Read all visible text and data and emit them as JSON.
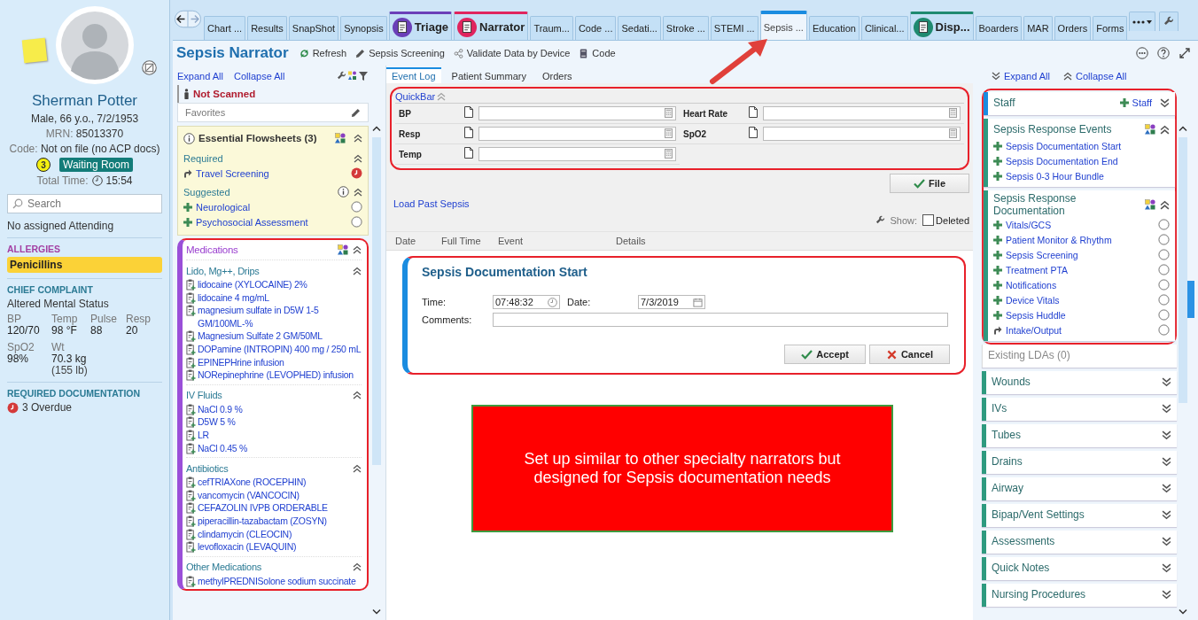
{
  "tabs": [
    {
      "label": "Chart ...",
      "kind": "small",
      "selected": false
    },
    {
      "label": "Results",
      "kind": "small",
      "selected": false
    },
    {
      "label": "SnapShot",
      "kind": "small",
      "selected": false
    },
    {
      "label": "Synopsis",
      "kind": "small",
      "selected": false
    },
    {
      "label": "Triage",
      "kind": "large",
      "selected": false,
      "color": "#6b3fb8"
    },
    {
      "label": "Narrator",
      "kind": "large",
      "selected": false,
      "color": "#e0245e"
    },
    {
      "label": "Traum...",
      "kind": "small",
      "selected": false
    },
    {
      "label": "Code ...",
      "kind": "small",
      "selected": false
    },
    {
      "label": "Sedati...",
      "kind": "small",
      "selected": false
    },
    {
      "label": "Stroke ...",
      "kind": "small",
      "selected": false
    },
    {
      "label": "STEMI ...",
      "kind": "small",
      "selected": false
    },
    {
      "label": "Sepsis ...",
      "kind": "small",
      "selected": true
    },
    {
      "label": "Education",
      "kind": "small",
      "selected": false
    },
    {
      "label": "Clinical...",
      "kind": "small",
      "selected": false
    },
    {
      "label": "Disp...",
      "kind": "large",
      "selected": false,
      "color": "#1f8a70"
    },
    {
      "label": "Boarders",
      "kind": "small",
      "selected": false
    },
    {
      "label": "MAR",
      "kind": "small",
      "selected": false
    },
    {
      "label": "Orders",
      "kind": "small",
      "selected": false
    },
    {
      "label": "Forms",
      "kind": "small",
      "selected": false
    }
  ],
  "patient": {
    "name": "Sherman Potter",
    "demographics": "Male, 66 y.o., 7/2/1953",
    "mrn_label": "MRN:",
    "mrn": "85013370",
    "code_label": "Code:",
    "code": "Not on file (no ACP docs)",
    "acuity": "3",
    "location": "Waiting Room",
    "total_time_label": "Total Time:",
    "total_time": "15:54",
    "search": {
      "placeholder": "Search"
    },
    "attending": "No assigned Attending",
    "allergies_heading": "ALLERGIES",
    "allergies": [
      "Penicillins"
    ],
    "complaint_heading": "CHIEF COMPLAINT",
    "complaint": "Altered Mental Status",
    "vitals": [
      {
        "label": "BP",
        "value": "120/70"
      },
      {
        "label": "Temp",
        "value": "98 °F"
      },
      {
        "label": "Pulse",
        "value": "88"
      },
      {
        "label": "Resp",
        "value": "20"
      },
      {
        "label": "SpO2",
        "value": "98%"
      },
      {
        "label": "Wt",
        "value": "70.3 kg",
        "note": "(155 lb)"
      }
    ],
    "required_heading": "REQUIRED DOCUMENTATION",
    "overdue": "3 Overdue"
  },
  "toolbar": {
    "title": "Sepsis Narrator",
    "actions": [
      {
        "label": "Refresh",
        "kind": "refresh"
      },
      {
        "label": "Sepsis Screening",
        "kind": "edit"
      },
      {
        "label": "Validate Data by Device",
        "kind": "share"
      },
      {
        "label": "Code",
        "kind": "book"
      }
    ]
  },
  "left": {
    "expand_all": "Expand All",
    "collapse_all": "Collapse All",
    "scan_status": "Not Scanned",
    "favorites": "Favorites",
    "essential": {
      "title": "Essential Flowsheets (3)",
      "groups": [
        {
          "title": "Required",
          "info": false,
          "items": [
            {
              "label": "Travel Screening",
              "kind": "link",
              "overdue": true
            }
          ]
        },
        {
          "title": "Suggested",
          "info": true,
          "items": [
            {
              "label": "Neurological",
              "kind": "add",
              "done": false
            },
            {
              "label": "Psychosocial Assessment",
              "kind": "add",
              "done": false
            }
          ]
        }
      ]
    },
    "medications": {
      "title": "Medications",
      "groups": [
        {
          "title": "Lido, Mg++, Drips",
          "items": [
            "lidocaine (XYLOCAINE) 2%",
            "lidocaine 4 mg/mL",
            "magnesium sulfate in D5W 1-5 GM/100ML-%",
            "Magnesium Sulfate 2 GM/50ML",
            "DOPamine (INTROPIN) 400 mg / 250 mL",
            "EPINEPHrine infusion",
            "NORepinephrine (LEVOPHED) infusion"
          ]
        },
        {
          "title": "IV Fluids",
          "items": [
            "NaCl 0.9 %",
            "D5W 5 %",
            "LR",
            "NaCl 0.45 %"
          ]
        },
        {
          "title": "Antibiotics",
          "items": [
            "cefTRIAXone (ROCEPHIN)",
            "vancomycin (VANCOCIN)",
            "CEFAZOLIN IVPB ORDERABLE",
            "piperacillin-tazabactam (ZOSYN)",
            "clindamycin (CLEOCIN)",
            "levofloxacin (LEVAQUIN)"
          ]
        },
        {
          "title": "Other Medications",
          "items": [
            "methylPREDNISolone sodium succinate"
          ]
        }
      ]
    }
  },
  "center": {
    "tabs": [
      {
        "label": "Event Log",
        "selected": true
      },
      {
        "label": "Patient Summary",
        "selected": false
      },
      {
        "label": "Orders",
        "selected": false
      }
    ],
    "quickbar": {
      "title": "QuickBar",
      "fields": [
        {
          "label": "BP"
        },
        {
          "label": "Heart Rate"
        },
        {
          "label": "Resp"
        },
        {
          "label": "SpO2"
        },
        {
          "label": "Temp"
        }
      ]
    },
    "file_button": "File",
    "load_past": "Load Past Sepsis",
    "show_label": "Show:",
    "deleted": {
      "label": "Deleted",
      "checked": false
    },
    "columns": [
      "Date",
      "Full Time",
      "Event",
      "Details"
    ],
    "event": {
      "title": "Sepsis Documentation Start",
      "time_label": "Time:",
      "time": "07:48:32",
      "date_label": "Date:",
      "date": "7/3/2019",
      "comments_label": "Comments:",
      "accept": "Accept",
      "cancel": "Cancel"
    },
    "note": "Set up similar to other specialty narrators but designed for Sepsis documentation needs"
  },
  "right": {
    "expand_all": "Expand All",
    "collapse_all": "Collapse All",
    "highlighted_sections": [
      {
        "title": "Staff",
        "kind": "header",
        "expanded": false,
        "action": "Staff"
      },
      {
        "title": "Sepsis Response Events",
        "kind": "list",
        "expanded": true,
        "items": [
          {
            "label": "Sepsis Documentation Start",
            "kind": "add"
          },
          {
            "label": "Sepsis Documentation End",
            "kind": "add"
          },
          {
            "label": "Sepsis 0-3 Hour Bundle",
            "kind": "add"
          }
        ]
      },
      {
        "title": "Sepsis Response Documentation",
        "kind": "list",
        "expanded": true,
        "items": [
          {
            "label": "Vitals/GCS",
            "kind": "add",
            "done": false
          },
          {
            "label": "Patient Monitor & Rhythm",
            "kind": "add",
            "done": false
          },
          {
            "label": "Sepsis Screening",
            "kind": "add",
            "done": false
          },
          {
            "label": "Treatment PTA",
            "kind": "add",
            "done": false
          },
          {
            "label": "Notifications",
            "kind": "add",
            "done": false
          },
          {
            "label": "Device Vitals",
            "kind": "add",
            "done": false
          },
          {
            "label": "Sepsis Huddle",
            "kind": "add",
            "done": false
          },
          {
            "label": "Intake/Output",
            "kind": "link",
            "done": false
          }
        ]
      }
    ],
    "sections": [
      {
        "title": "Existing LDAs (0)",
        "kind": "plain"
      },
      {
        "title": "Wounds",
        "kind": "header",
        "expanded": false
      },
      {
        "title": "IVs",
        "kind": "header",
        "expanded": false
      },
      {
        "title": "Tubes",
        "kind": "header",
        "expanded": false
      },
      {
        "title": "Drains",
        "kind": "header",
        "expanded": false
      },
      {
        "title": "Airway",
        "kind": "header",
        "expanded": false
      },
      {
        "title": "Bipap/Vent Settings",
        "kind": "header",
        "expanded": false
      },
      {
        "title": "Assessments",
        "kind": "header",
        "expanded": false
      },
      {
        "title": "Quick Notes",
        "kind": "header",
        "expanded": false
      },
      {
        "title": "Nursing Procedures",
        "kind": "header",
        "expanded": false
      }
    ]
  }
}
